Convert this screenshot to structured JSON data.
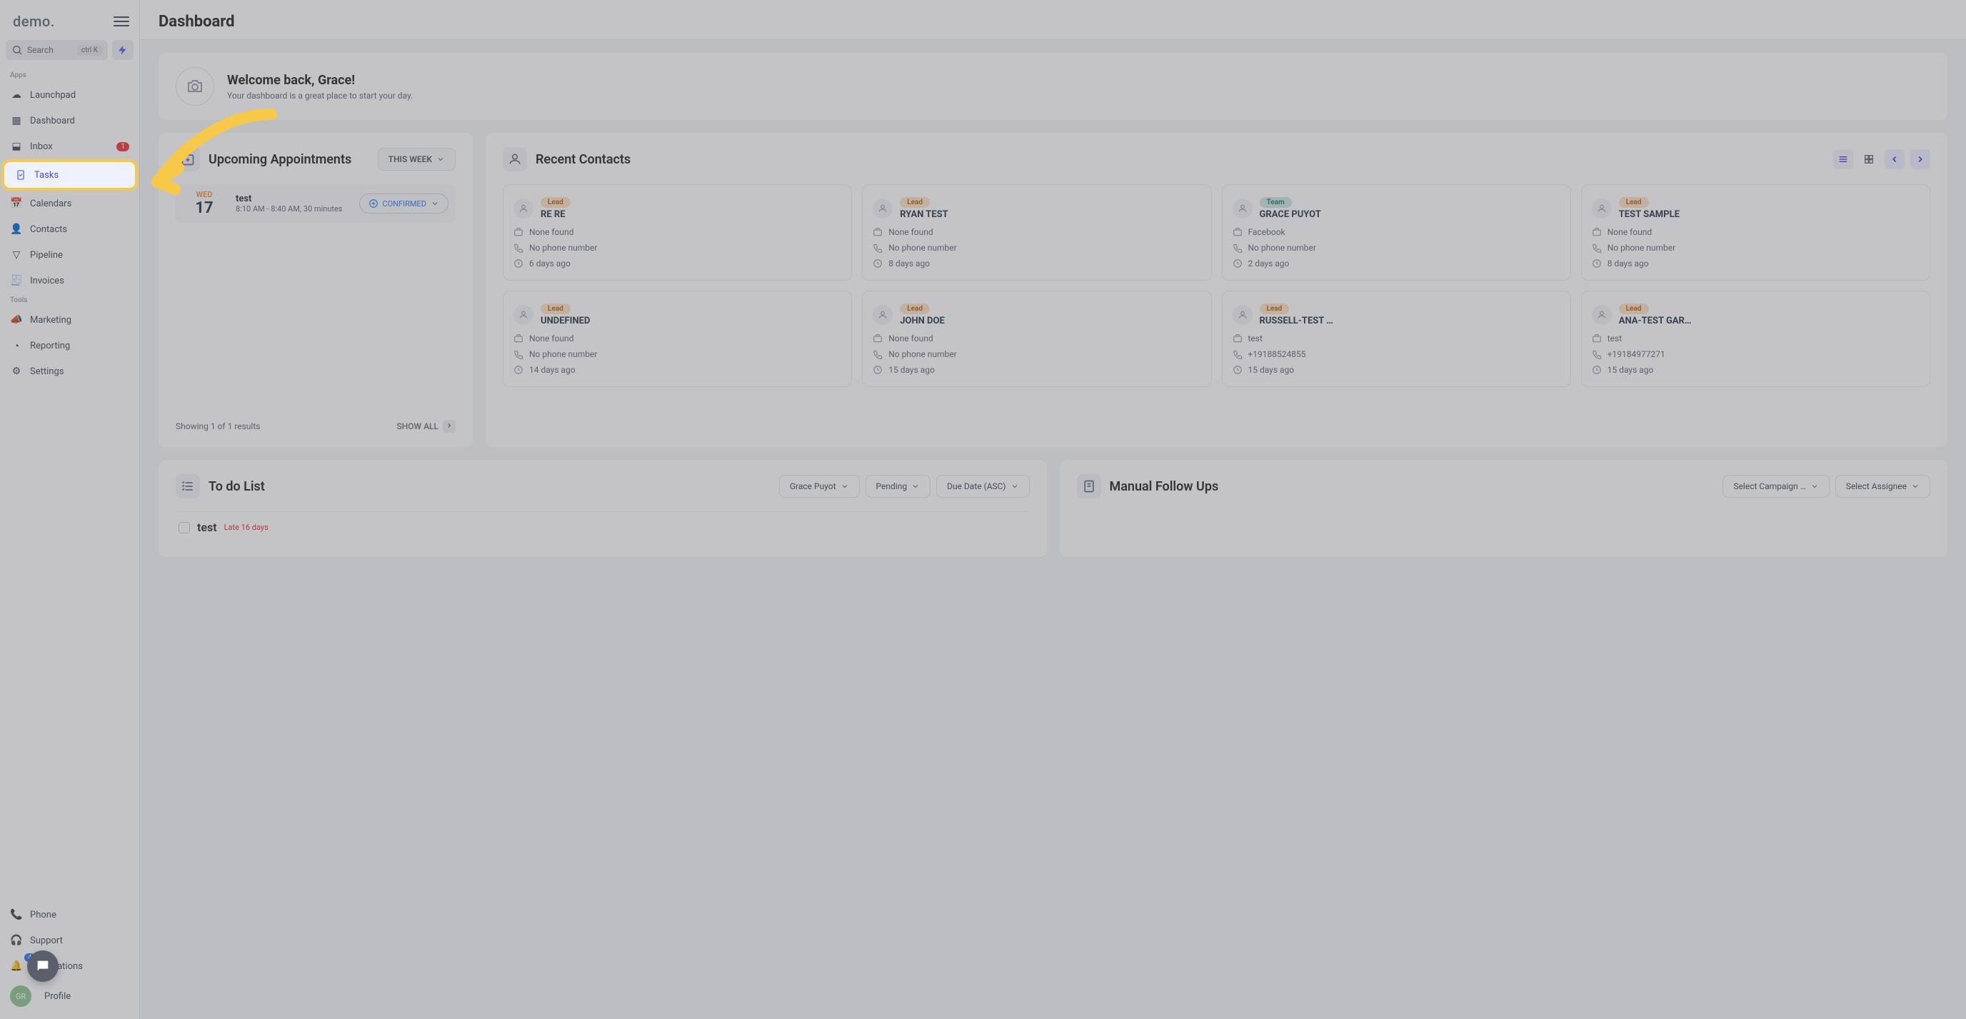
{
  "logo": "demo.",
  "search": {
    "label": "Search",
    "shortcut": "ctrl K"
  },
  "sidebar": {
    "apps_label": "Apps",
    "tools_label": "Tools",
    "items": [
      {
        "label": "Launchpad"
      },
      {
        "label": "Dashboard"
      },
      {
        "label": "Inbox",
        "badge": "1"
      },
      {
        "label": "Tasks"
      },
      {
        "label": "Calendars"
      },
      {
        "label": "Contacts"
      },
      {
        "label": "Pipeline"
      },
      {
        "label": "Invoices"
      }
    ],
    "tools": [
      {
        "label": "Marketing"
      },
      {
        "label": "Reporting"
      },
      {
        "label": "Settings"
      }
    ],
    "bottom": [
      {
        "label": "Phone"
      },
      {
        "label": "Support"
      },
      {
        "label": "Notifications",
        "count": "4"
      },
      {
        "label": "Profile",
        "initials": "GR"
      }
    ]
  },
  "top_title": "Dashboard",
  "welcome": {
    "heading": "Welcome back, Grace!",
    "sub": "Your dashboard is a great place to start your day."
  },
  "appointments": {
    "title": "Upcoming Appointments",
    "filter": "THIS WEEK",
    "date_day": "WED",
    "date_num": "17",
    "apt_name": "test",
    "apt_time": "8:10 AM - 8:40 AM, 30 minutes",
    "status": "CONFIRMED",
    "showing": "Showing 1 of 1 results",
    "show_all": "SHOW ALL"
  },
  "contacts_section": {
    "title": "Recent Contacts",
    "cards": [
      {
        "tag": "Lead",
        "tagclass": "",
        "name": "RE RE",
        "company": "None found",
        "phone": "No phone number",
        "time": "6 days ago"
      },
      {
        "tag": "Lead",
        "tagclass": "",
        "name": "RYAN TEST",
        "company": "None found",
        "phone": "No phone number",
        "time": "8 days ago"
      },
      {
        "tag": "Team",
        "tagclass": "team",
        "name": "GRACE PUYOT",
        "company": "Facebook",
        "phone": "No phone number",
        "time": "2 days ago"
      },
      {
        "tag": "Lead",
        "tagclass": "",
        "name": "TEST SAMPLE",
        "company": "None found",
        "phone": "No phone number",
        "time": "8 days ago"
      },
      {
        "tag": "Lead",
        "tagclass": "",
        "name": "UNDEFINED",
        "company": "None found",
        "phone": "No phone number",
        "time": "14 days ago"
      },
      {
        "tag": "Lead",
        "tagclass": "",
        "name": "JOHN DOE",
        "company": "None found",
        "phone": "No phone number",
        "time": "15 days ago"
      },
      {
        "tag": "Lead",
        "tagclass": "",
        "name": "RUSSELL-TEST …",
        "company": "test",
        "phone": "+19188524855",
        "time": "15 days ago"
      },
      {
        "tag": "Lead",
        "tagclass": "",
        "name": "ANA-TEST GAR…",
        "company": "test",
        "phone": "+19184977271",
        "time": "15 days ago"
      }
    ]
  },
  "todo": {
    "title": "To do List",
    "filters": [
      "Grace Puyot",
      "Pending",
      "Due Date (ASC)"
    ],
    "item_name": "test",
    "item_due": "Late 16 days"
  },
  "followups": {
    "title": "Manual Follow Ups",
    "filters": [
      "Select Campaign …",
      "Select Assignee"
    ]
  }
}
